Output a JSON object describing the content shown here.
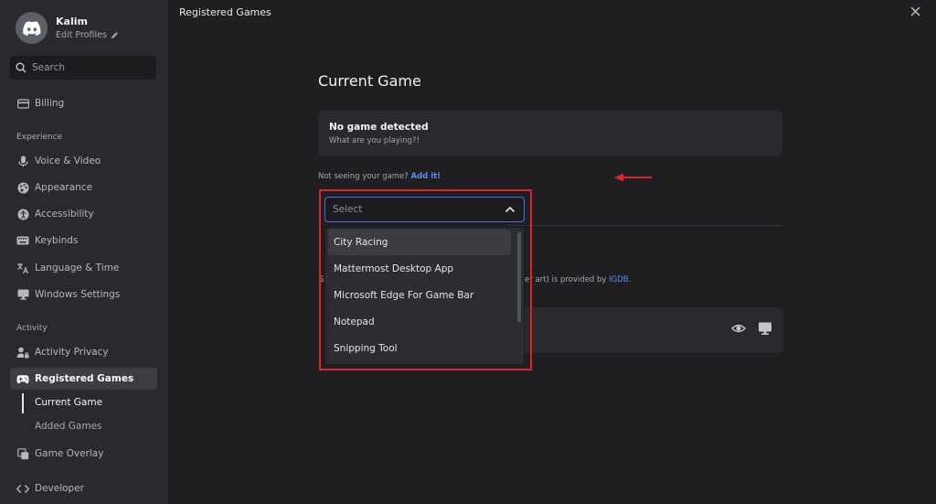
{
  "profile": {
    "name": "Kalim",
    "edit_label": "Edit Profiles"
  },
  "search": {
    "placeholder": "Search"
  },
  "sidebar": {
    "billing": "Billing",
    "experience_label": "Experience",
    "experience_items": [
      "Voice & Video",
      "Appearance",
      "Accessibility",
      "Keybinds",
      "Language & Time",
      "Windows Settings"
    ],
    "activity_label": "Activity",
    "activity_privacy": "Activity Privacy",
    "registered_games": "Registered Games",
    "sub_current_game": "Current Game",
    "sub_added_games": "Added Games",
    "game_overlay": "Game Overlay",
    "developer": "Developer"
  },
  "main": {
    "header": "Registered Games",
    "section_title": "Current Game",
    "game_box": {
      "title": "No game detected",
      "subtitle": "What are you playing?!"
    },
    "not_seeing": "Not seeing your game?",
    "add_link": "Add it!",
    "behind_s": "S",
    "behind_text_pre": "ver art) is provided by ",
    "behind_igdb": "IGDB",
    "behind_text_post": "."
  },
  "dropdown": {
    "placeholder": "Select",
    "options": [
      "City Racing",
      "Mattermost Desktop App",
      "Microsoft Edge For Game Bar",
      "Notepad",
      "Snipping Tool"
    ]
  },
  "colors": {
    "accent": "#5865f2",
    "link": "#5c8cf0",
    "highlight": "#d9252b"
  }
}
